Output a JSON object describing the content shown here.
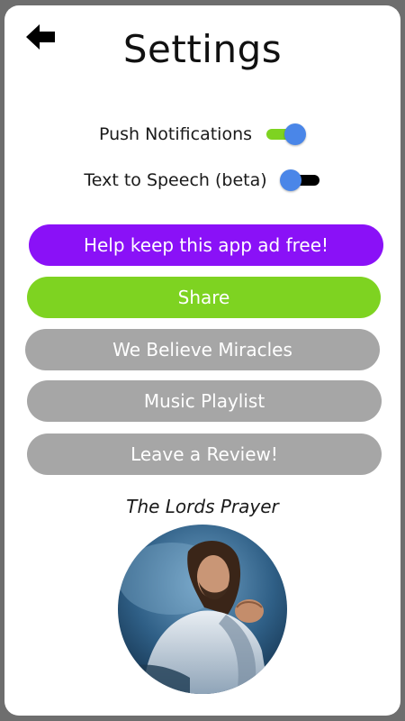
{
  "header": {
    "title": "Settings",
    "back_icon": "arrow-left-icon"
  },
  "toggles": [
    {
      "label": "Push Notifications",
      "on": true,
      "track_color": "#7ed321"
    },
    {
      "label": "Text to Speech (beta)",
      "on": false,
      "track_color": "#000000"
    }
  ],
  "buttons": [
    {
      "label": "Help keep this app ad free!",
      "color": "#8a11f7"
    },
    {
      "label": "Share",
      "color": "#7ed321"
    },
    {
      "label": "We Believe Miracles",
      "color": "#a6a6a6"
    },
    {
      "label": "Music Playlist",
      "color": "#a6a6a6"
    },
    {
      "label": "Leave a Review!",
      "color": "#a6a6a6"
    }
  ],
  "prayer": {
    "caption": "The Lords Prayer",
    "image": "praying-figure-image"
  },
  "colors": {
    "knob": "#4a86e8",
    "frame": "#6e6e6e"
  }
}
